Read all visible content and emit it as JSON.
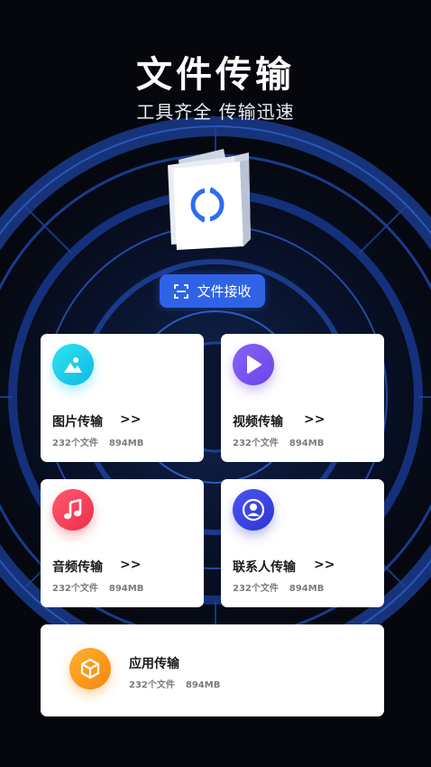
{
  "header": {
    "title": "文件传输",
    "subtitle": "工具齐全 传输迅速"
  },
  "receive_button": {
    "label": "文件接收",
    "icon": "scan-icon"
  },
  "cards": [
    {
      "id": "picture",
      "name": "图片传输",
      "arrow": ">>",
      "count": "232个文件",
      "size": "894MB",
      "icon": "image-icon",
      "color": "#1cc8ee"
    },
    {
      "id": "video",
      "name": "视频传输",
      "arrow": ">>",
      "count": "232个文件",
      "size": "894MB",
      "icon": "play-icon",
      "color": "#7653ef"
    },
    {
      "id": "audio",
      "name": "音频传输",
      "arrow": ">>",
      "count": "232个文件",
      "size": "894MB",
      "icon": "music-note-icon",
      "color": "#f23a55"
    },
    {
      "id": "contacts",
      "name": "联系人传输",
      "arrow": ">>",
      "count": "232个文件",
      "size": "894MB",
      "icon": "person-icon",
      "color": "#3640e3"
    },
    {
      "id": "apps",
      "name": "应用传输",
      "count": "232个文件",
      "size": "894MB",
      "icon": "cube-icon",
      "color": "#f7951a"
    }
  ],
  "colors": {
    "background": "#05070d",
    "accent_blue": "#2f63e6"
  }
}
